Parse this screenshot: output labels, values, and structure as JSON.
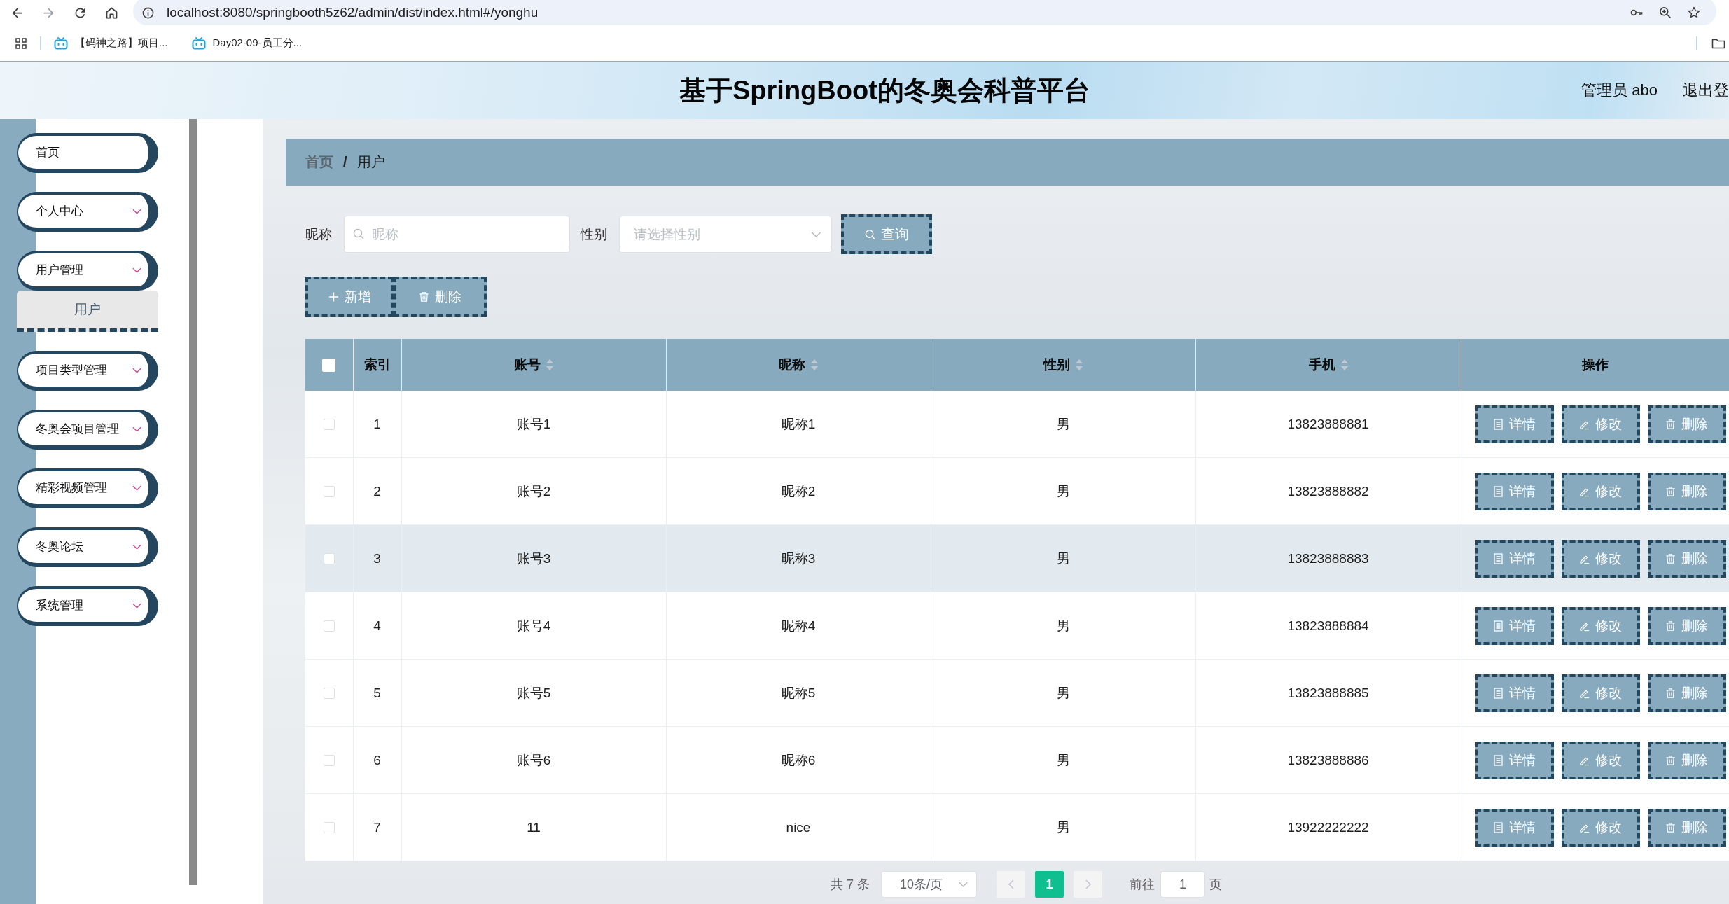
{
  "browser": {
    "url": "localhost:8080/springbooth5z62/admin/dist/index.html#/yonghu",
    "bookmarks": [
      {
        "label": "【码神之路】项目..."
      },
      {
        "label": "Day02-09-员工分..."
      }
    ]
  },
  "header": {
    "title": "基于SpringBoot的冬奥会科普平台",
    "user": "管理员 abo",
    "logout": "退出登"
  },
  "sidebar": {
    "items": [
      {
        "label": "首页",
        "kind": "link",
        "selected": false
      },
      {
        "label": "个人中心",
        "kind": "menu",
        "selected": false
      },
      {
        "label": "用户管理",
        "kind": "menu",
        "selected": false,
        "children": [
          {
            "label": "用户",
            "selected": true
          }
        ]
      },
      {
        "label": "项目类型管理",
        "kind": "menu",
        "selected": false
      },
      {
        "label": "冬奥会项目管理",
        "kind": "menu",
        "selected": false
      },
      {
        "label": "精彩视频管理",
        "kind": "menu",
        "selected": false
      },
      {
        "label": "冬奥论坛",
        "kind": "menu",
        "selected": false
      },
      {
        "label": "系统管理",
        "kind": "menu",
        "selected": false
      }
    ]
  },
  "breadcrumb": {
    "items": [
      {
        "label": "首页",
        "current": false
      },
      {
        "label": "用户",
        "current": true
      }
    ],
    "separator": "/"
  },
  "search": {
    "fields": [
      {
        "label": "昵称",
        "kind": "text",
        "placeholder": "昵称"
      },
      {
        "label": "性别",
        "kind": "select",
        "placeholder": "请选择性别"
      }
    ],
    "button": "查询"
  },
  "actions": [
    {
      "label": "新增",
      "kind": "add"
    },
    {
      "label": "删除",
      "kind": "delete"
    }
  ],
  "table": {
    "checked": false,
    "columns": [
      {
        "label": "索引",
        "sortable": false
      },
      {
        "label": "账号",
        "sortable": true
      },
      {
        "label": "昵称",
        "sortable": true
      },
      {
        "label": "性别",
        "sortable": true
      },
      {
        "label": "手机",
        "sortable": true
      },
      {
        "label": "操作",
        "sortable": false
      }
    ],
    "rows": [
      {
        "checked": false,
        "hovered": false,
        "cells": [
          "1",
          "账号1",
          "昵称1",
          "男",
          "13823888881"
        ],
        "actions": [
          {
            "label": "详情",
            "kind": "detail"
          },
          {
            "label": "修改",
            "kind": "edit"
          },
          {
            "label": "删除",
            "kind": "delete"
          }
        ]
      },
      {
        "checked": false,
        "hovered": false,
        "cells": [
          "2",
          "账号2",
          "昵称2",
          "男",
          "13823888882"
        ],
        "actions": [
          {
            "label": "详情",
            "kind": "detail"
          },
          {
            "label": "修改",
            "kind": "edit"
          },
          {
            "label": "删除",
            "kind": "delete"
          }
        ]
      },
      {
        "checked": false,
        "hovered": true,
        "cells": [
          "3",
          "账号3",
          "昵称3",
          "男",
          "13823888883"
        ],
        "actions": [
          {
            "label": "详情",
            "kind": "detail"
          },
          {
            "label": "修改",
            "kind": "edit"
          },
          {
            "label": "删除",
            "kind": "delete"
          }
        ]
      },
      {
        "checked": false,
        "hovered": false,
        "cells": [
          "4",
          "账号4",
          "昵称4",
          "男",
          "13823888884"
        ],
        "actions": [
          {
            "label": "详情",
            "kind": "detail"
          },
          {
            "label": "修改",
            "kind": "edit"
          },
          {
            "label": "删除",
            "kind": "delete"
          }
        ]
      },
      {
        "checked": false,
        "hovered": false,
        "cells": [
          "5",
          "账号5",
          "昵称5",
          "男",
          "13823888885"
        ],
        "actions": [
          {
            "label": "详情",
            "kind": "detail"
          },
          {
            "label": "修改",
            "kind": "edit"
          },
          {
            "label": "删除",
            "kind": "delete"
          }
        ]
      },
      {
        "checked": false,
        "hovered": false,
        "cells": [
          "6",
          "账号6",
          "昵称6",
          "男",
          "13823888886"
        ],
        "actions": [
          {
            "label": "详情",
            "kind": "detail"
          },
          {
            "label": "修改",
            "kind": "edit"
          },
          {
            "label": "删除",
            "kind": "delete"
          }
        ]
      },
      {
        "checked": false,
        "hovered": false,
        "cells": [
          "7",
          "11",
          "nice",
          "男",
          "13922222222"
        ],
        "actions": [
          {
            "label": "详情",
            "kind": "detail"
          },
          {
            "label": "修改",
            "kind": "edit"
          },
          {
            "label": "删除",
            "kind": "delete"
          }
        ]
      }
    ]
  },
  "pagination": {
    "total": "共 7 条",
    "page_size": "10条/页",
    "prev": {
      "disabled": true
    },
    "pages": [
      {
        "label": "1",
        "selected": true
      }
    ],
    "next": {
      "disabled": true
    },
    "goto": {
      "label": "前往",
      "value": "1",
      "suffix": "页"
    }
  }
}
